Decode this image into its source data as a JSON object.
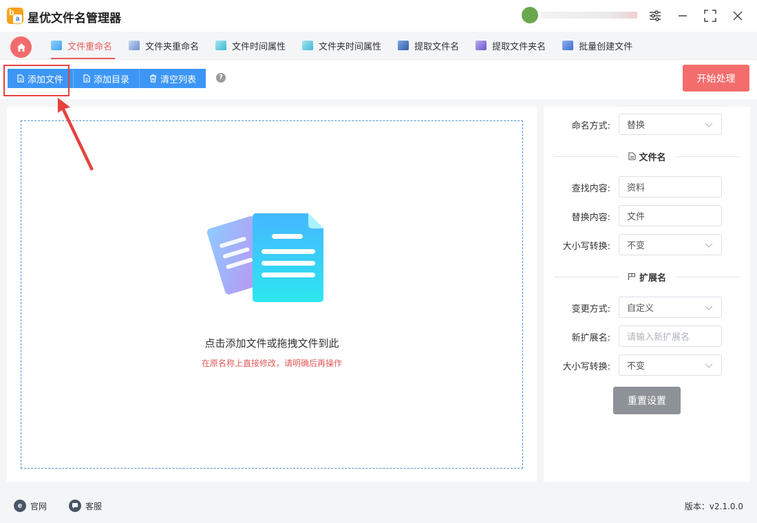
{
  "app": {
    "title": "星优文件名管理器"
  },
  "tabs": [
    {
      "label": "文件重命名",
      "icon": "rename-icon",
      "color": "#5fb4f3",
      "active": true
    },
    {
      "label": "文件夹重命名",
      "icon": "folder-rename-icon",
      "color": "#8fa8d8",
      "active": false
    },
    {
      "label": "文件时间属性",
      "icon": "file-time-icon",
      "color": "#5bc0de",
      "active": false
    },
    {
      "label": "文件夹时间属性",
      "icon": "folder-time-icon",
      "color": "#5bc0de",
      "active": false
    },
    {
      "label": "提取文件名",
      "icon": "extract-filename-icon",
      "color": "#3f6fb5",
      "active": false
    },
    {
      "label": "提取文件夹名",
      "icon": "extract-foldername-icon",
      "color": "#7a6fd0",
      "active": false
    },
    {
      "label": "批量创建文件",
      "icon": "batch-create-icon",
      "color": "#4a7fd6",
      "active": false
    }
  ],
  "toolbar": {
    "add_file": "添加文件",
    "add_dir": "添加目录",
    "clear_list": "清空列表",
    "help": "?",
    "start": "开始处理"
  },
  "drop": {
    "main_text": "点击添加文件或拖拽文件到此",
    "sub_text": "在原名称上直接修改，请明确后再操作"
  },
  "settings": {
    "naming_mode_label": "命名方式:",
    "naming_mode_value": "替换",
    "filename_section": "文件名",
    "find_label": "查找内容:",
    "find_value": "资料",
    "replace_label": "替换内容:",
    "replace_value": "文件",
    "case1_label": "大小写转换:",
    "case1_value": "不变",
    "ext_section": "扩展名",
    "change_mode_label": "变更方式:",
    "change_mode_value": "自定义",
    "new_ext_label": "新扩展名:",
    "new_ext_placeholder": "请输入新扩展名",
    "case2_label": "大小写转换:",
    "case2_value": "不变",
    "reset": "重置设置"
  },
  "footer": {
    "website": "官网",
    "website_icon": "e",
    "support": "客服",
    "version": "版本：v2.1.0.0"
  },
  "colors": {
    "accent_red": "#f46d6d",
    "primary_blue": "#3d96f5",
    "annotation_red": "#e8403b"
  }
}
